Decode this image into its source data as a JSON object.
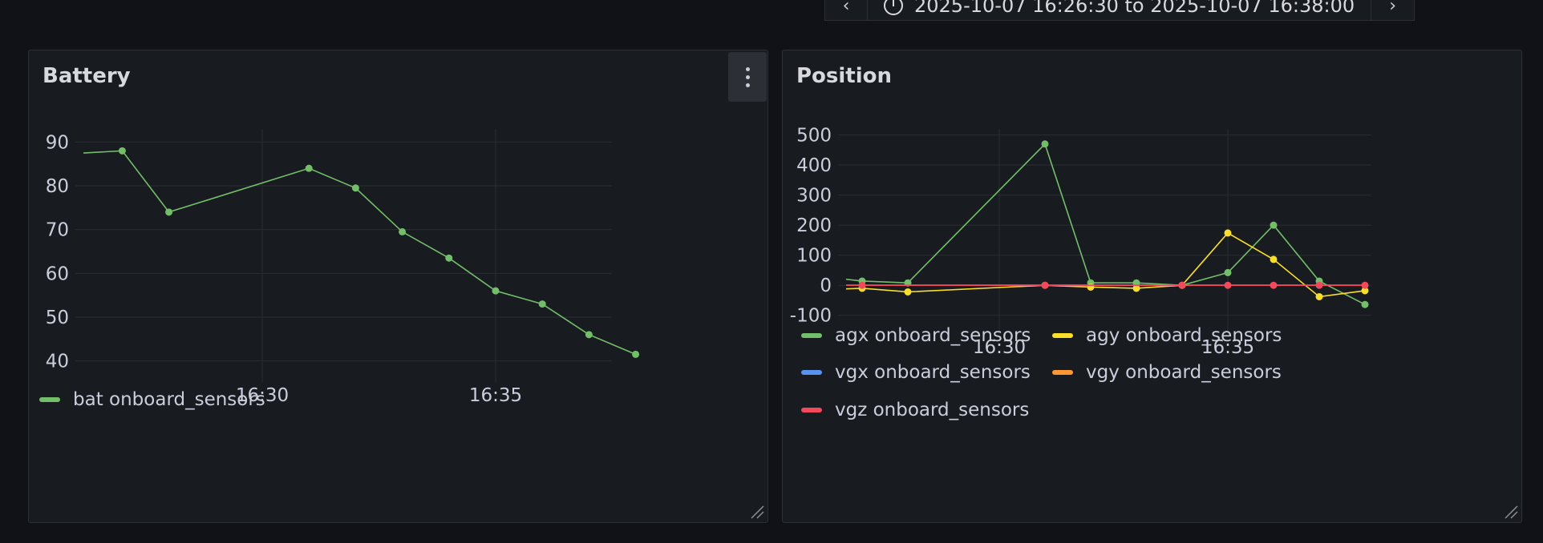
{
  "toolbar": {
    "prev_icon": "chevron-left-icon",
    "next_icon": "chevron-right-icon",
    "clock_icon": "clock-icon",
    "range_text": "2025-10-07 16:26:30 to 2025-10-07 16:38:00"
  },
  "panels": {
    "battery": {
      "title": "Battery",
      "menu_icon": "kebab-menu-icon"
    },
    "position": {
      "title": "Position"
    }
  },
  "chart_data": [
    {
      "type": "line",
      "title": "Battery",
      "x_ticks": [
        "16:30",
        "16:35"
      ],
      "y_ticks": [
        40,
        50,
        60,
        70,
        80,
        90
      ],
      "ylim": [
        37,
        93
      ],
      "grid": true,
      "legend_placement": "bottom-left",
      "series": [
        {
          "name": "bat onboard_sensors",
          "color": "#73bf69",
          "x": [
            "16:26:30",
            "16:27:00",
            "16:28:00",
            "16:31:00",
            "16:32:00",
            "16:33:00",
            "16:34:00",
            "16:35:00",
            "16:36:00",
            "16:37:00",
            "16:38:00"
          ],
          "y": [
            87.5,
            88,
            74,
            84,
            79.5,
            69.5,
            63.5,
            56,
            53,
            46,
            41.5
          ],
          "markers": [
            false,
            true,
            true,
            true,
            true,
            true,
            true,
            true,
            true,
            true,
            true
          ]
        }
      ]
    },
    {
      "type": "line",
      "title": "Position",
      "x_ticks": [
        "16:30",
        "16:35"
      ],
      "y_ticks": [
        -100,
        0,
        100,
        200,
        300,
        400,
        500
      ],
      "ylim": [
        -130,
        520
      ],
      "grid": true,
      "legend_placement": "bottom-left",
      "series": [
        {
          "name": "agx onboard_sensors",
          "color": "#73bf69",
          "x": [
            "16:26:20",
            "16:27:00",
            "16:28:00",
            "16:31:00",
            "16:32:00",
            "16:33:00",
            "16:34:00",
            "16:35:00",
            "16:36:00",
            "16:37:00",
            "16:38:00"
          ],
          "y": [
            20,
            14,
            8,
            470,
            8,
            8,
            0,
            42,
            200,
            14,
            -64
          ],
          "markers": [
            false,
            true,
            true,
            true,
            true,
            true,
            true,
            true,
            true,
            true,
            true
          ]
        },
        {
          "name": "agy onboard_sensors",
          "color": "#fade2a",
          "x": [
            "16:26:20",
            "16:27:00",
            "16:28:00",
            "16:31:00",
            "16:32:00",
            "16:33:00",
            "16:34:00",
            "16:35:00",
            "16:36:00",
            "16:37:00",
            "16:38:00"
          ],
          "y": [
            -12,
            -10,
            -22,
            0,
            -6,
            -10,
            0,
            174,
            86,
            -38,
            -18
          ],
          "markers": [
            false,
            true,
            true,
            true,
            true,
            true,
            true,
            true,
            true,
            true,
            true
          ]
        },
        {
          "name": "vgx onboard_sensors",
          "color": "#5794f2",
          "x": [
            "16:26:20",
            "16:38:00"
          ],
          "y": [
            0,
            0
          ],
          "markers": [
            false,
            false
          ]
        },
        {
          "name": "vgy onboard_sensors",
          "color": "#ff9830",
          "x": [
            "16:26:20",
            "16:38:00"
          ],
          "y": [
            0,
            0
          ],
          "markers": [
            false,
            false
          ]
        },
        {
          "name": "vgz onboard_sensors",
          "color": "#f2495c",
          "x": [
            "16:26:20",
            "16:27:00",
            "16:31:00",
            "16:34:00",
            "16:35:00",
            "16:36:00",
            "16:37:00",
            "16:38:00"
          ],
          "y": [
            0,
            0,
            0,
            0,
            0,
            0,
            0,
            0
          ],
          "markers": [
            false,
            true,
            true,
            true,
            true,
            true,
            true,
            true
          ]
        }
      ]
    }
  ]
}
